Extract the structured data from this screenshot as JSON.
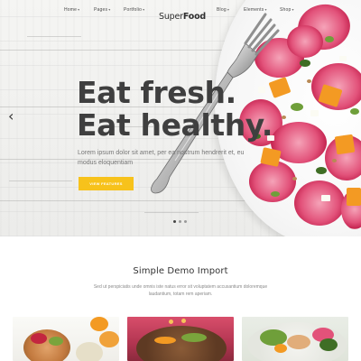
{
  "nav": {
    "items": [
      {
        "label": "Home",
        "caret": "▾"
      },
      {
        "label": "Pages",
        "caret": "▾"
      },
      {
        "label": "Portfolio",
        "caret": "▾"
      },
      {
        "label": "Blog",
        "caret": "▾"
      },
      {
        "label": "Elements",
        "caret": "▾"
      },
      {
        "label": "Shop",
        "caret": "▾"
      }
    ],
    "logo_regular": "Super",
    "logo_bold": "Food"
  },
  "hero": {
    "headline_line1": "Eat fresh.",
    "headline_line2": "Eat healthy.",
    "lede": "Lorem ipsum dolor sit amet, per ea nostrum hendrerit et, eu modus eloquentiam",
    "cta_label": "VIEW FEATURES",
    "prev_arrow": "‹",
    "slide_count": 3,
    "active_slide": 1
  },
  "section": {
    "title": "Simple Demo Import",
    "description": "Sed ut perspiciatis unde omnis iste natus error sit voluptatem accusantium doloremque laudantium, totam rem aperiam."
  },
  "colors": {
    "accent": "#f7c21b",
    "headline": "#3f3f3f",
    "radish_pink": "#e2527a",
    "orange": "#f39a23",
    "herb_green": "#6f9f3a"
  },
  "icons": {
    "prev": "chevron-left-icon",
    "caret": "chevron-down-icon"
  }
}
